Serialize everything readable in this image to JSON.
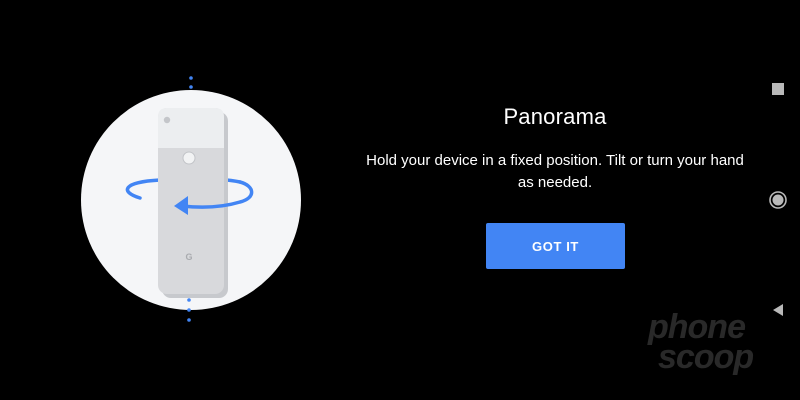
{
  "dialog": {
    "title": "Panorama",
    "instructions": "Hold your device in a fixed position. Tilt or turn your hand as needed.",
    "confirm_label": "GOT IT",
    "illustration": "phone-rotate-illustration"
  },
  "navbar": {
    "recents_icon": "square-icon",
    "home_icon": "circle-icon",
    "back_icon": "triangle-back-icon"
  },
  "watermark": {
    "line1": "phone",
    "line2": "scoop"
  },
  "colors": {
    "background": "#000000",
    "accent": "#4285f4",
    "text": "#ffffff",
    "circle": "#f5f6f8",
    "phone": "#d8d9dc"
  }
}
